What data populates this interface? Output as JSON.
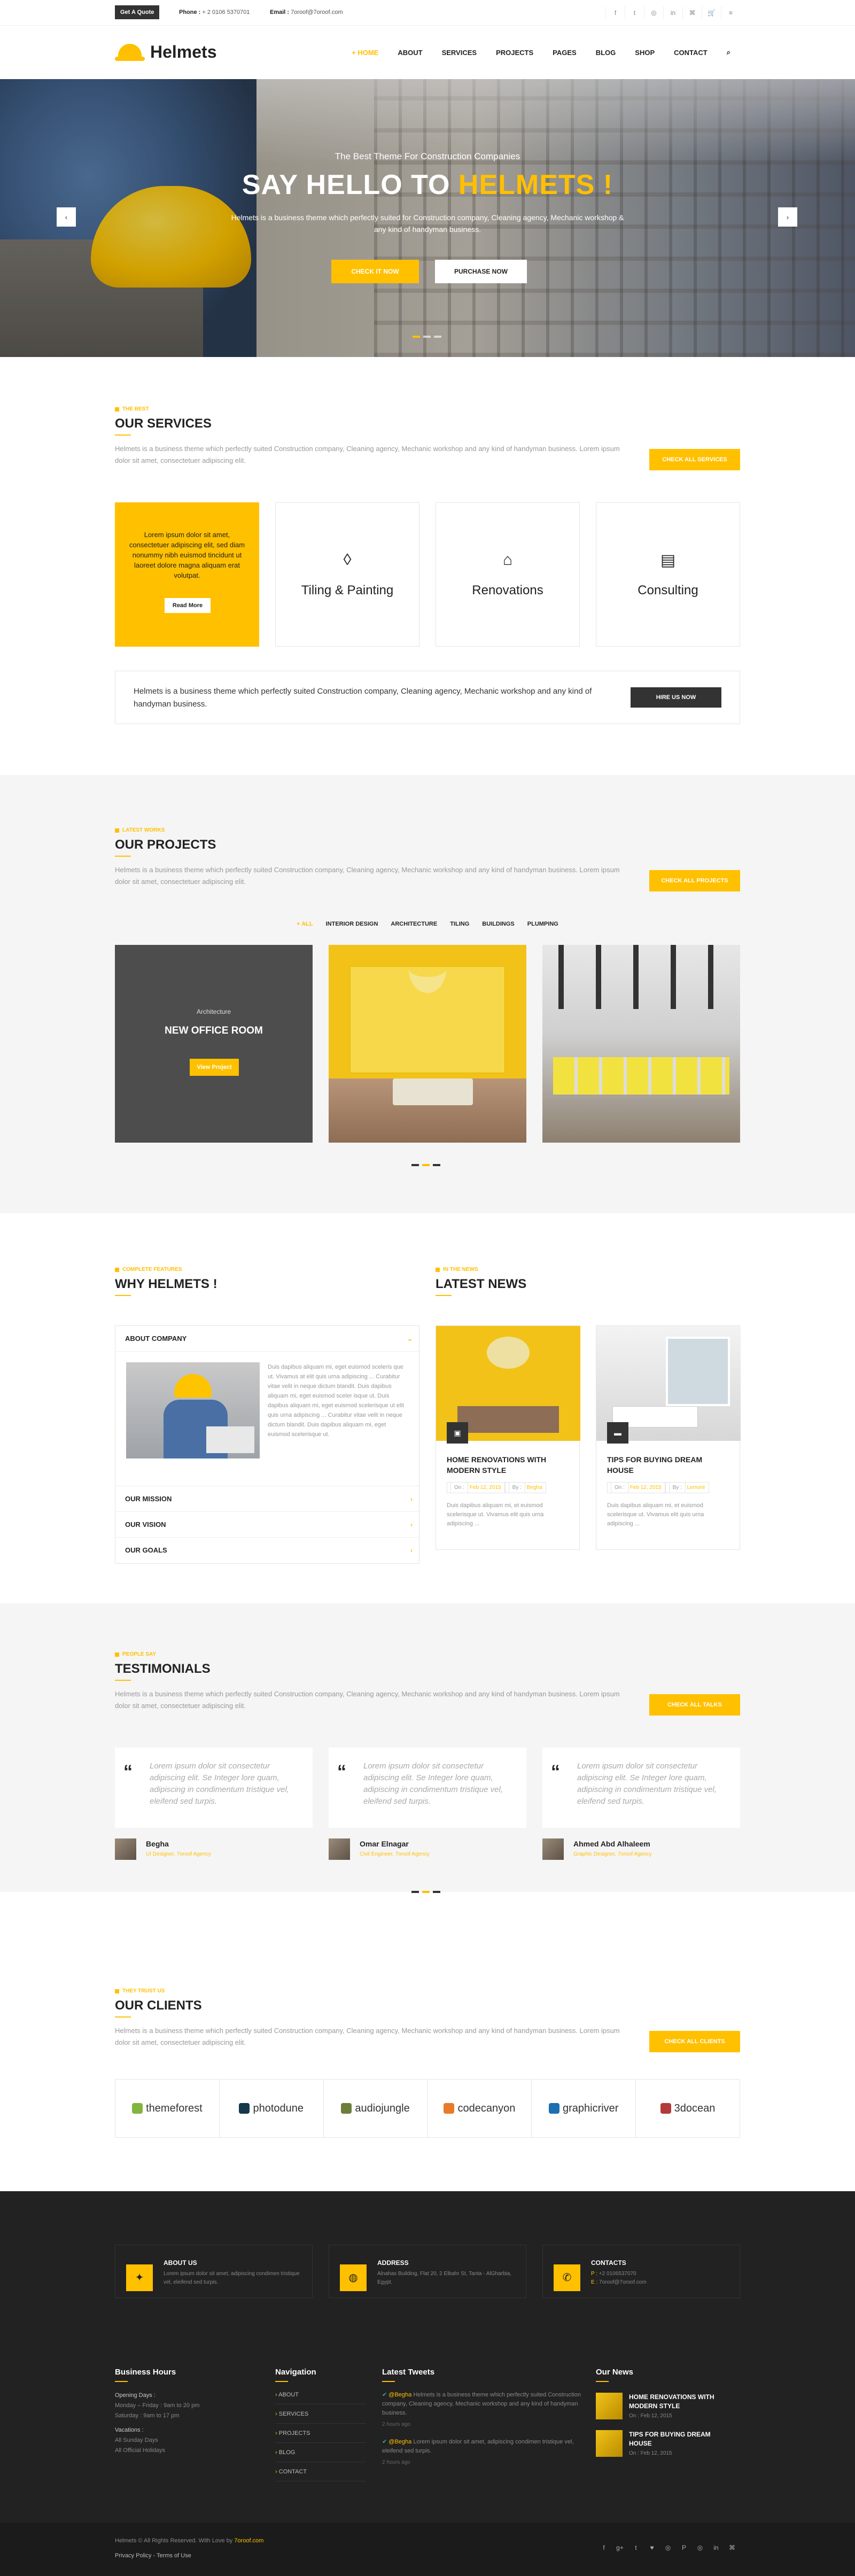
{
  "colors": {
    "accent": "#ffc000",
    "dark": "#222222"
  },
  "topbar": {
    "quote_label": "Get A Quote",
    "phone_label": "Phone :",
    "phone": "+ 2 0106 5370701",
    "email_label": "Email :",
    "email": "7oroof@7oroof.com",
    "social": [
      {
        "icon": "facebook-icon",
        "glyph": "f"
      },
      {
        "icon": "twitter-icon",
        "glyph": "t"
      },
      {
        "icon": "instagram-icon",
        "glyph": "◎"
      },
      {
        "icon": "linkedin-icon",
        "glyph": "in"
      },
      {
        "icon": "rss-icon",
        "glyph": "⌘"
      },
      {
        "icon": "cart-icon",
        "glyph": "🛒"
      },
      {
        "icon": "menu-icon",
        "glyph": "≡"
      }
    ]
  },
  "header": {
    "brand": "Helmets",
    "nav": [
      "+ HOME",
      "ABOUT",
      "SERVICES",
      "PROJECTS",
      "PAGES",
      "BLOG",
      "SHOP",
      "CONTACT"
    ],
    "search_icon": "⌕"
  },
  "hero": {
    "kicker": "The Best Theme For Construction Companies",
    "title_a": "SAY HELLO TO",
    "title_b": "HELMETS !",
    "text": "Helmets is a business theme which perfectly suited for Construction company, Cleaning agency, Mechanic workshop & any kind of handyman business.",
    "btn1": "CHECK IT NOW",
    "btn2": "PURCHASE NOW",
    "prev": "‹",
    "next": "›"
  },
  "services": {
    "kicker": "The Best",
    "title": "OUR SERVICES",
    "desc": "Helmets is a business theme which perfectly suited Construction company, Cleaning agency, Mechanic workshop and any kind of handyman business. Lorem ipsum dolor sit amet, consectetuer adipiscing elit.",
    "button": "CHECK ALL SERVICES",
    "intro": "Lorem ipsum dolor sit amet, consectetuer adipiscing elit, sed diam nonummy nibh euismod tincidunt ut laoreet dolore magna aliquam erat volutpat.",
    "read_more": "Read More",
    "items": [
      {
        "icon": "drop-icon",
        "glyph": "◊",
        "title": "Tiling & Painting"
      },
      {
        "icon": "house-icon",
        "glyph": "⌂",
        "title": "Renovations"
      },
      {
        "icon": "clipboard-icon",
        "glyph": "▤",
        "title": "Consulting"
      }
    ],
    "hire_text": "Helmets is a business theme which perfectly suited Construction company, Cleaning agency, Mechanic workshop and any kind of handyman business.",
    "hire_button": "HIRE US NOW"
  },
  "projects": {
    "kicker": "Latest Works",
    "title": "OUR PROJECTS",
    "desc": "Helmets is a business theme which perfectly suited Construction company, Cleaning agency, Mechanic workshop and any kind of handyman business. Lorem ipsum dolor sit amet, consectetuer adipiscing elit.",
    "button": "CHECK ALL PROJECTS",
    "filters": [
      "+ ALL",
      "INTERIOR DESIGN",
      "ARCHITECTURE",
      "TILING",
      "BUILDINGS",
      "PLUMPING"
    ],
    "featured": {
      "category": "Architecture",
      "name": "NEW OFFICE ROOM",
      "button": "View Project"
    }
  },
  "why": {
    "kicker": "Complete Features",
    "title": "WHY HELMETS !",
    "accordion": [
      {
        "title": "ABOUT COMPANY",
        "text": "Duis dapibus aliquam mi, eget euismod sceleris que ut. Vivamus at elit quis urna adipiscing ... Curabitur vitae velit in neque dictum blandit. Duis dapibus aliquam mi, eget euismod sceler isque ut. Duis dapibus aliquam mi, eget euismod scelerisque ut elit quis urna adipiscing ... Curabitur vitae velit in neque dictum blandit. Duis dapibus aliquam mi, eget euismod scelerisque ut."
      },
      {
        "title": "OUR MISSION"
      },
      {
        "title": "OUR VISION"
      },
      {
        "title": "OUR GOALS"
      }
    ]
  },
  "news": {
    "kicker": "In The News",
    "title": "LATEST NEWS",
    "items": [
      {
        "title": "HOME RENOVATIONS WITH MODERN STYLE",
        "date_label": "On :",
        "date": "Feb 12, 2015",
        "by_label": "By :",
        "author": "Begha",
        "text": "Duis dapibus aliquam mi, et euismod scelerisque ut. Vivamus elit quis urna adipiscing ..."
      },
      {
        "title": "TIPS FOR BUYING DREAM HOUSE",
        "date_label": "On :",
        "date": "Feb 12, 2015",
        "by_label": "By :",
        "author": "Lemoré",
        "text": "Duis dapibus aliquam mi, et euismod scelerisque ut. Vivamus elit quis urna adipiscing ..."
      }
    ]
  },
  "testimonials": {
    "kicker": "People Say",
    "title": "TESTIMONIALS",
    "desc": "Helmets is a business theme which perfectly suited Construction company, Cleaning agency, Mechanic workshop and any kind of handyman business. Lorem ipsum dolor sit amet, consectetuer adipiscing elit.",
    "button": "CHECK ALL TALKS",
    "items": [
      {
        "quote": "Lorem ipsum dolor sit consectetur adipiscing elit. Se Integer lore quam, adipiscing in condimentum tristique vel, eleifend sed turpis.",
        "name": "Begha",
        "role": "UI Designer, 7oroof Agency"
      },
      {
        "quote": "Lorem ipsum dolor sit consectetur adipiscing elit. Se Integer lore quam, adipiscing in condimentum tristique vel, eleifend sed turpis.",
        "name": "Omar Elnagar",
        "role": "Civil Engineer, 7oroof Agency"
      },
      {
        "quote": "Lorem ipsum dolor sit consectetur adipiscing elit. Se Integer lore quam, adipiscing in condimentum tristique vel, eleifend sed turpis.",
        "name": "Ahmed Abd Alhaleem",
        "role": "Graphic Designer, 7oroof Agency"
      }
    ]
  },
  "clients": {
    "kicker": "They Trust Us",
    "title": "OUR CLIENTS",
    "desc": "Helmets is a business theme which perfectly suited Construction company, Cleaning agency, Mechanic workshop and any kind of handyman business. Lorem ipsum dolor sit amet, consectetuer adipiscing elit.",
    "button": "CHECK ALL CLIENTS",
    "logos": [
      {
        "name": "themeforest",
        "color": "#82b440"
      },
      {
        "name": "photodune",
        "color": "#16384b"
      },
      {
        "name": "audiojungle",
        "color": "#6b7f3a"
      },
      {
        "name": "codecanyon",
        "color": "#e77a2b"
      },
      {
        "name": "graphicriver",
        "color": "#1e6fb0"
      },
      {
        "name": "3docean",
        "color": "#b33a3a"
      }
    ]
  },
  "footer": {
    "cards": [
      {
        "icon": "bulb-icon",
        "glyph": "✦",
        "title": "ABOUT US",
        "text": "Lorem ipsum dolor sit amet, adipiscing condimen tristique vel, eleifend sed turpis."
      },
      {
        "icon": "map-icon",
        "glyph": "◍",
        "title": "ADDRESS",
        "text": "Alnahas Building, Flat 20, 2 Elbahr St, Tanta - AlGharbia, Egypt."
      },
      {
        "icon": "phone-icon",
        "glyph": "✆",
        "title": "CONTACTS",
        "phone_label": "P :",
        "phone": "+2 0106537070",
        "email_label": "E :",
        "email": "7oroof@7oroof.com"
      }
    ],
    "hours": {
      "title": "Business Hours",
      "opening": "Opening Days :",
      "l1": "Monday – Friday : 9am to 20 pm",
      "l2": "Saturday : 9am to 17 pm",
      "vac": "Vacations :",
      "l3": "All Sunday Days",
      "l4": "All Official Holidays"
    },
    "nav": {
      "title": "Navigation",
      "items": [
        "ABOUT",
        "SERVICES",
        "PROJECTS",
        "BLOG",
        "CONTACT"
      ]
    },
    "tweets": {
      "title": "Latest Tweets",
      "items": [
        {
          "handle": "@Begha",
          "text": "Helmets is a business theme which perfectly suited Construction company, Cleaning agency, Mechanic workshop and any kind of handyman business.",
          "time": "2 hours ago"
        },
        {
          "handle": "@Begha",
          "text": "Lorem ipsum dolor sit amet, adipiscing condimen tristique vel, eleifend sed turpis.",
          "time": "2 hours ago"
        }
      ]
    },
    "news": {
      "title": "Our News",
      "items": [
        {
          "title": "HOME RENOVATIONS WITH MODERN STYLE",
          "date_label": "On :",
          "date": "Feb 12, 2015"
        },
        {
          "title": "TIPS FOR BUYING DREAM HOUSE",
          "date_label": "On :",
          "date": "Feb 12, 2015"
        }
      ]
    },
    "copyright": "Helmets © All Rights Reserved. With Love by",
    "copyright_link": "7oroof.com",
    "policy": "Privacy Policy - Terms of Use",
    "social": [
      "f",
      "g+",
      "t",
      "♥",
      "◎",
      "P",
      "◎",
      "in",
      "⌘"
    ]
  }
}
